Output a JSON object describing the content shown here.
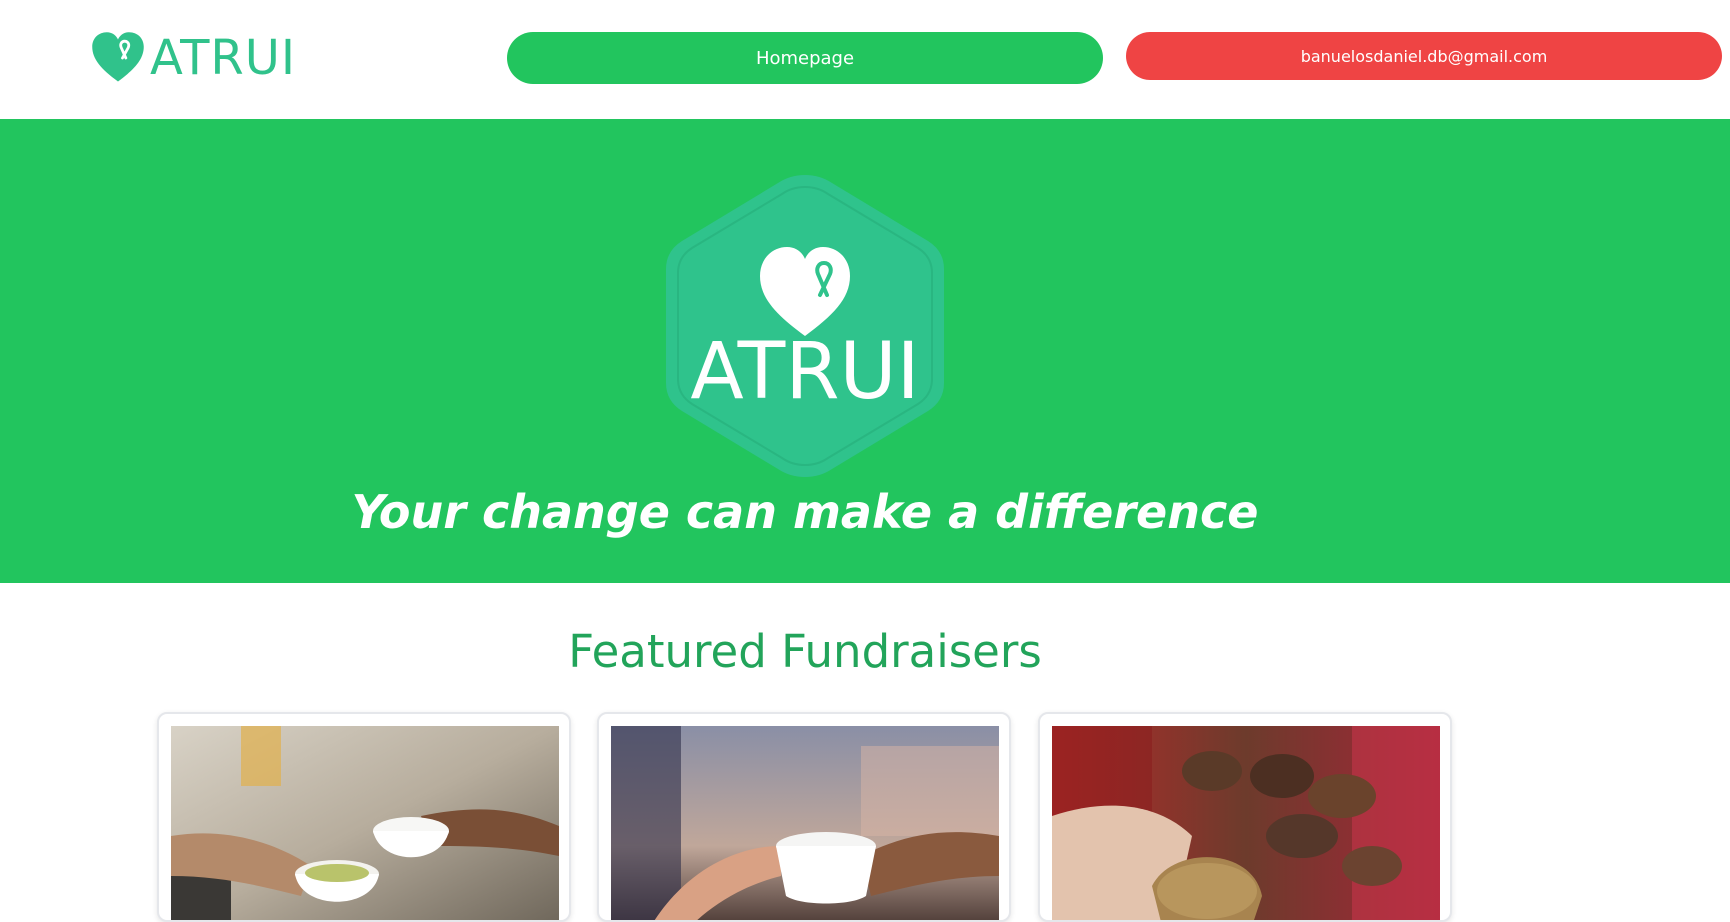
{
  "header": {
    "brand": {
      "name": "ATRUI",
      "icon": "heart-ribbon-icon",
      "color": "#30c28b"
    },
    "nav": {
      "home_label": "Homepage",
      "user_email": "banuelosdaniel.db@gmail.com"
    }
  },
  "hero": {
    "emblem_text": "ATRUI",
    "emblem_icon": "heart-ribbon-icon",
    "tagline": "Your change can make a difference",
    "background": "#22c55e",
    "emblem_color": "#2fc38c"
  },
  "featured": {
    "title": "Featured Fundraisers",
    "cards": [
      {
        "image": "food-bowl-handoff-photo"
      },
      {
        "image": "cup-handoff-photo"
      },
      {
        "image": "hands-grain-photo"
      }
    ]
  },
  "colors": {
    "accent_green": "#22c55e",
    "danger_red": "#ef4444",
    "brand_teal": "#30c28b"
  }
}
